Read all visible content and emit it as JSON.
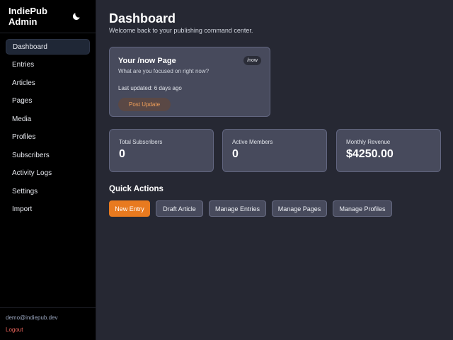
{
  "sidebar": {
    "brand": "IndiePub Admin",
    "theme_icon": "moon-icon",
    "items": [
      {
        "label": "Dashboard",
        "active": true
      },
      {
        "label": "Entries"
      },
      {
        "label": "Articles"
      },
      {
        "label": "Pages"
      },
      {
        "label": "Media"
      },
      {
        "label": "Profiles"
      },
      {
        "label": "Subscribers"
      },
      {
        "label": "Activity Logs"
      },
      {
        "label": "Settings"
      },
      {
        "label": "Import"
      }
    ],
    "email": "demo@indiepub.dev",
    "logout": "Logout"
  },
  "main": {
    "title": "Dashboard",
    "subtitle": "Welcome back to your publishing command center.",
    "now_card": {
      "title": "Your /now Page",
      "question": "What are you focused on right now?",
      "updated": "Last updated: 6 days ago",
      "button": "Post Update",
      "badge": "/now"
    },
    "stats": [
      {
        "label": "Total Subscribers",
        "value": "0"
      },
      {
        "label": "Active Members",
        "value": "0"
      },
      {
        "label": "Monthly Revenue",
        "value": "$4250.00"
      }
    ],
    "quick_actions": {
      "title": "Quick Actions",
      "buttons": [
        "New Entry",
        "Draft Article",
        "Manage Entries",
        "Manage Pages",
        "Manage Profiles"
      ]
    }
  },
  "colors": {
    "accent": "#e87a1f",
    "background": "#262833",
    "card": "#474a5c",
    "sidebar": "#000000",
    "logout": "#f0675e"
  }
}
